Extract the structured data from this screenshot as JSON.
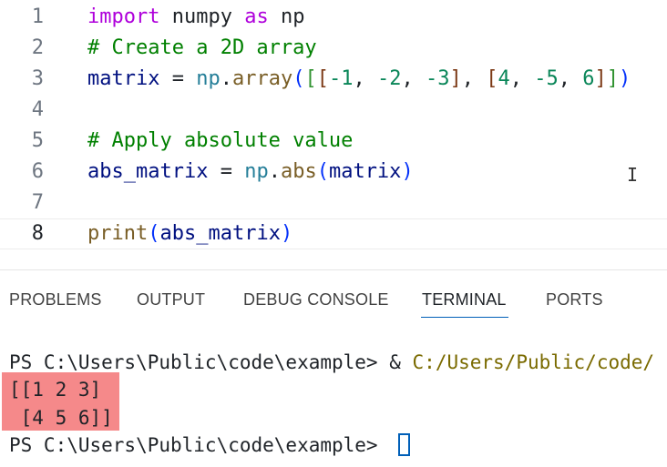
{
  "editor": {
    "lines": [
      {
        "number": "1",
        "tokens": [
          {
            "t": "import",
            "c": "keyword"
          },
          {
            "t": " numpy ",
            "c": "plain"
          },
          {
            "t": "as",
            "c": "keyword"
          },
          {
            "t": " np",
            "c": "plain"
          }
        ]
      },
      {
        "number": "2",
        "tokens": [
          {
            "t": "# Create a 2D array",
            "c": "comment"
          }
        ]
      },
      {
        "number": "3",
        "tokens": [
          {
            "t": "matrix",
            "c": "var"
          },
          {
            "t": " = ",
            "c": "punct"
          },
          {
            "t": "np",
            "c": "module"
          },
          {
            "t": ".",
            "c": "punct"
          },
          {
            "t": "array",
            "c": "func"
          },
          {
            "t": "(",
            "c": "br1"
          },
          {
            "t": "[",
            "c": "br2"
          },
          {
            "t": "[",
            "c": "br3"
          },
          {
            "t": "-1",
            "c": "num"
          },
          {
            "t": ", ",
            "c": "punct"
          },
          {
            "t": "-2",
            "c": "num"
          },
          {
            "t": ", ",
            "c": "punct"
          },
          {
            "t": "-3",
            "c": "num"
          },
          {
            "t": "]",
            "c": "br3"
          },
          {
            "t": ", ",
            "c": "punct"
          },
          {
            "t": "[",
            "c": "br3"
          },
          {
            "t": "4",
            "c": "num"
          },
          {
            "t": ", ",
            "c": "punct"
          },
          {
            "t": "-5",
            "c": "num"
          },
          {
            "t": ", ",
            "c": "punct"
          },
          {
            "t": "6",
            "c": "num"
          },
          {
            "t": "]",
            "c": "br3"
          },
          {
            "t": "]",
            "c": "br2"
          },
          {
            "t": ")",
            "c": "br1"
          }
        ]
      },
      {
        "number": "4",
        "tokens": []
      },
      {
        "number": "5",
        "tokens": [
          {
            "t": "# Apply absolute value",
            "c": "comment"
          }
        ]
      },
      {
        "number": "6",
        "tokens": [
          {
            "t": "abs_matrix",
            "c": "var"
          },
          {
            "t": " = ",
            "c": "punct"
          },
          {
            "t": "np",
            "c": "module"
          },
          {
            "t": ".",
            "c": "punct"
          },
          {
            "t": "abs",
            "c": "func"
          },
          {
            "t": "(",
            "c": "br1"
          },
          {
            "t": "matrix",
            "c": "var"
          },
          {
            "t": ")",
            "c": "br1"
          }
        ]
      },
      {
        "number": "7",
        "tokens": []
      },
      {
        "number": "8",
        "tokens": [
          {
            "t": "print",
            "c": "func"
          },
          {
            "t": "(",
            "c": "br1"
          },
          {
            "t": "abs_matrix",
            "c": "var"
          },
          {
            "t": ")",
            "c": "br1"
          }
        ]
      }
    ],
    "active_line": "8",
    "mouse_cursor_glyph": "I"
  },
  "panel": {
    "tabs": [
      {
        "label": "PROBLEMS",
        "active": false
      },
      {
        "label": "OUTPUT",
        "active": false
      },
      {
        "label": "DEBUG CONSOLE",
        "active": false
      },
      {
        "label": "TERMINAL",
        "active": true
      },
      {
        "label": "PORTS",
        "active": false
      }
    ],
    "terminal": {
      "prompt_1": "PS C:\\Users\\Public\\code\\example> ",
      "command_amp": "& ",
      "command_path": "C:/Users/Public/code/",
      "output_1": "[[1 2 3]",
      "output_2": " [4 5 6]]",
      "prompt_2": "PS C:\\Users\\Public\\code\\example> "
    },
    "colors": {
      "highlight": "#f5898a",
      "active_tab_underline": "#005fb8"
    }
  }
}
